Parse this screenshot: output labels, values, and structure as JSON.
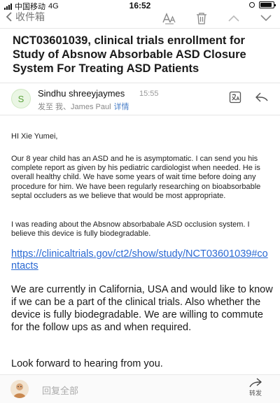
{
  "status_bar": {
    "carrier": "中国移动",
    "network": "4G",
    "time": "16:52",
    "battery_level": 0.9
  },
  "nav": {
    "back_label": "收件箱",
    "icons": [
      "font-size-icon",
      "trash-icon",
      "chevron-up-icon",
      "chevron-down-icon"
    ]
  },
  "email": {
    "subject": "NCT03601039, clinical trials enrollment for Study of Absnow Absorbable ASD Closure System For Treating ASD Patients",
    "sender": {
      "initial": "S",
      "name": "Sindhu shreeyjaymes",
      "time": "15:55",
      "recipients": "发至 我、James Paul",
      "detail_label": "详情"
    },
    "greeting": "HI Xie Yumei,",
    "paragraph1": "Our 8 year child has an ASD and he is asymptomatic. I can send you his complete report as given by his pediatric cardiologist when needed. He is overall healthy child. We have some years of wait time before doing any procedure for him. We have been regularly researching on bioabsorbable septal occluders as we believe that would be most appropriate.",
    "paragraph2": "I was reading about the Absnow absorbabale ASD occlusion system. I believe this device is fully biodegradable.",
    "link": "https://clinicaltrials.gov/ct2/show/study/NCT03601039#contacts",
    "paragraph3": "We are currently in California, USA and would like to know if we can be a part of the clinical trials. Also whether the device is fully biodegradable. We are willing to commute for the follow ups as and when required.",
    "closing": "Look forward to hearing from you."
  },
  "bottom_bar": {
    "reply_all_label": "回复全部",
    "forward_label": "转发"
  },
  "colors": {
    "link": "#2b6ad3",
    "detail": "#4a7fc8",
    "avatar_green": "#5aa23a"
  }
}
